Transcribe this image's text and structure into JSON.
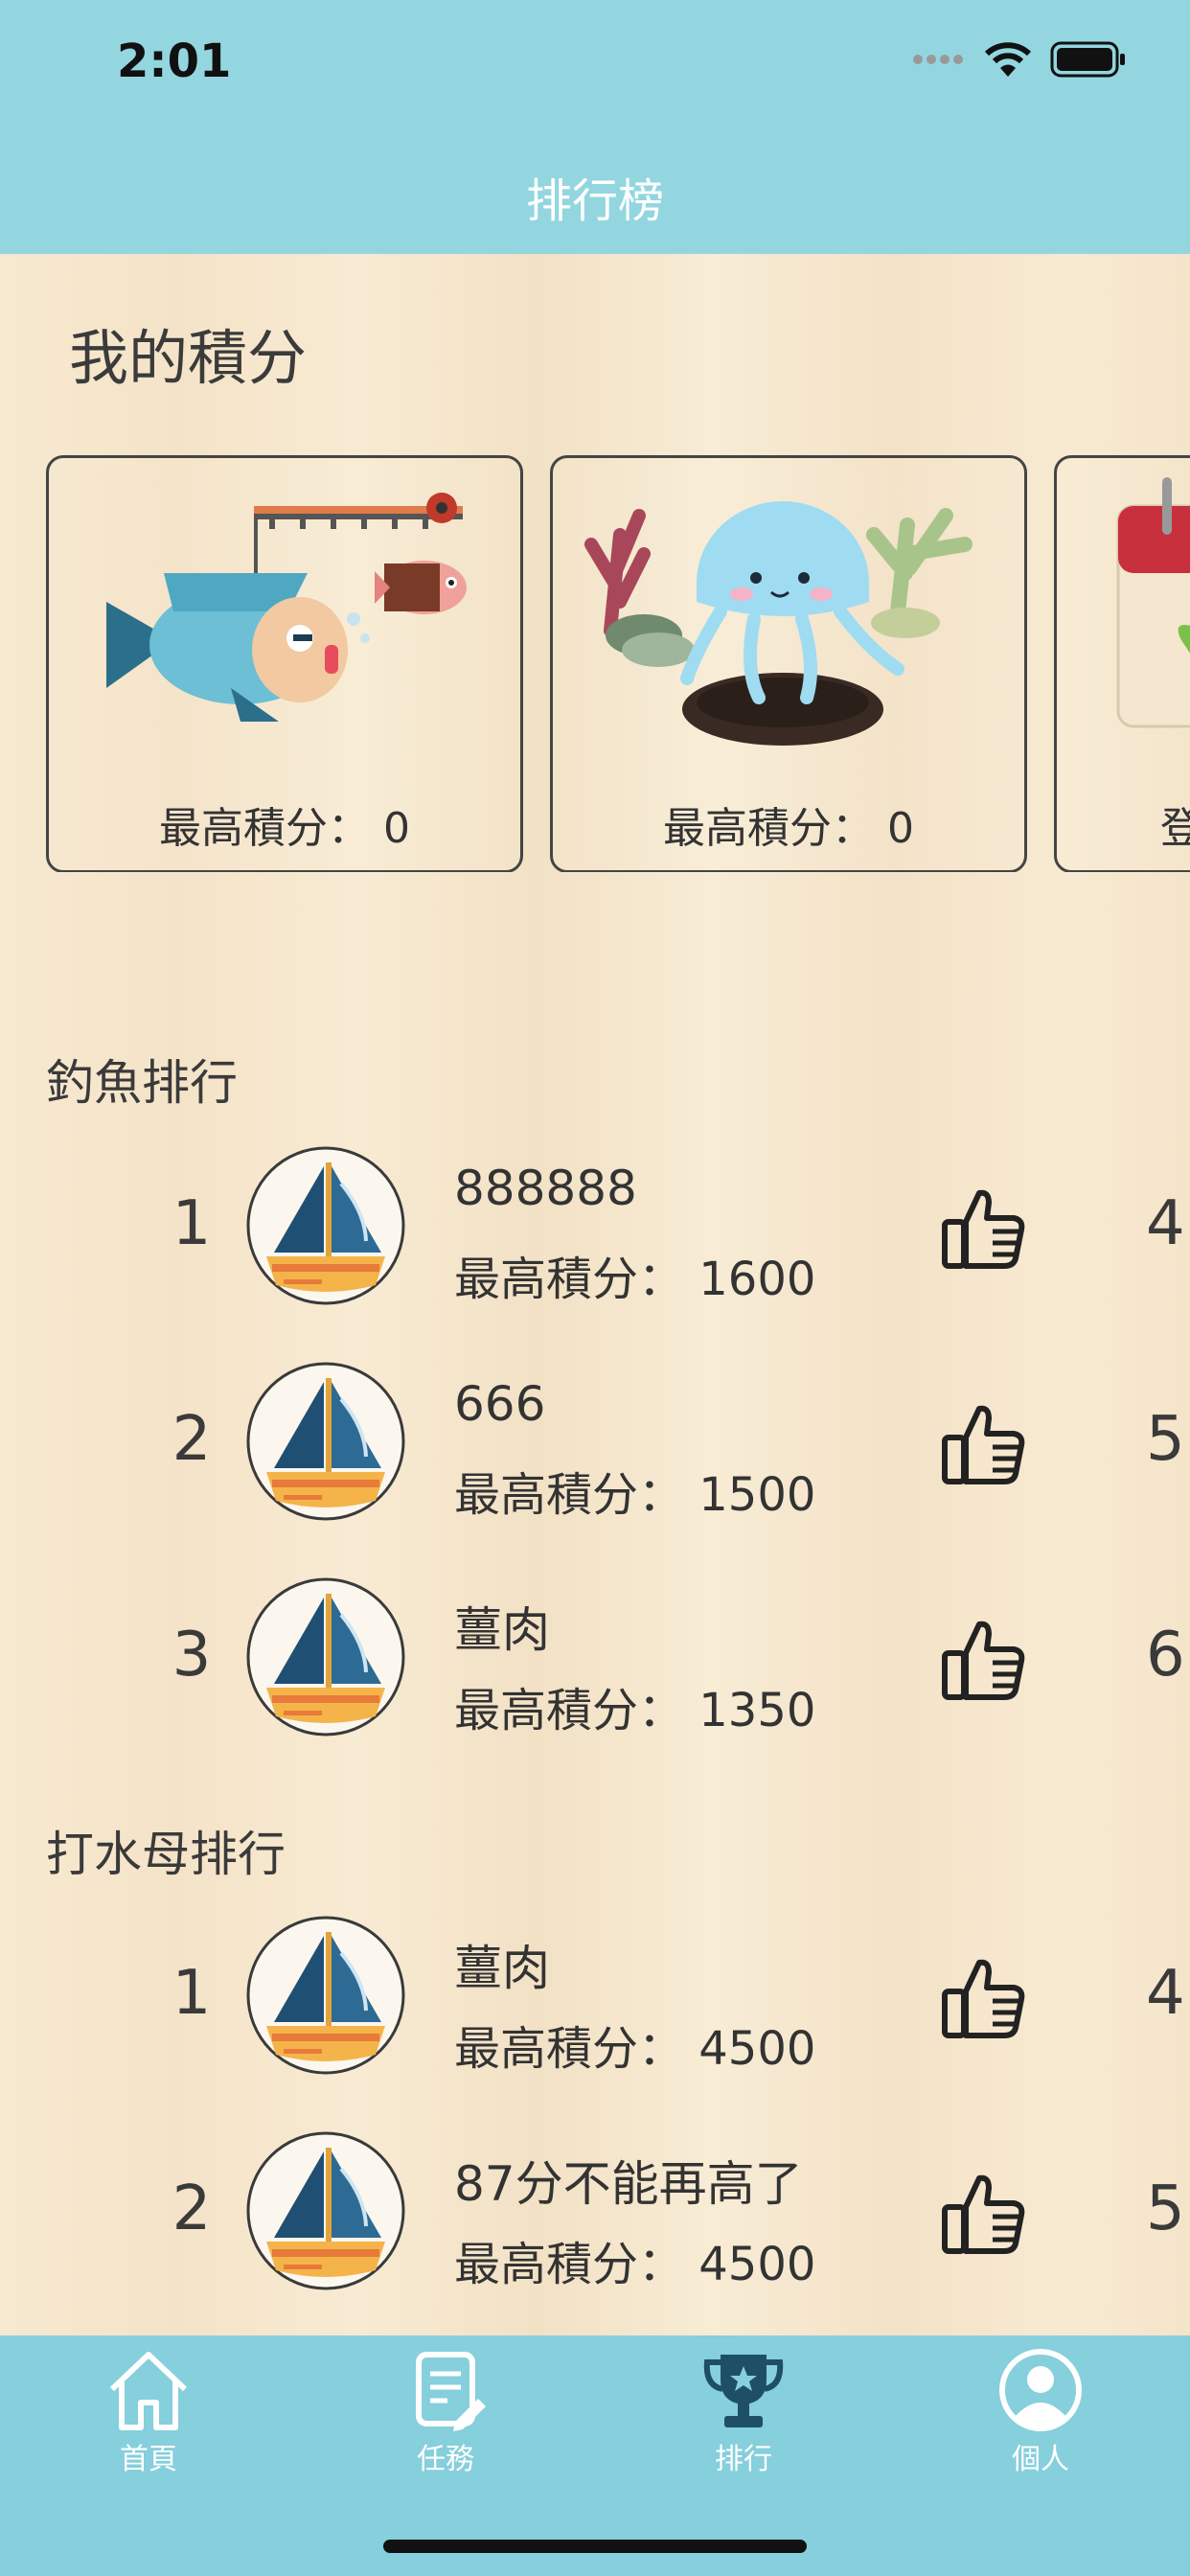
{
  "status_bar": {
    "time": "2:01"
  },
  "nav": {
    "title": "排行榜"
  },
  "my_score": {
    "title": "我的積分",
    "cards": [
      {
        "game": "fishing",
        "label": "最高積分：  0"
      },
      {
        "game": "jellyfish",
        "label": "最高積分：  0"
      },
      {
        "game": "calendar",
        "label": "登"
      }
    ]
  },
  "fishing_ranking": {
    "title": "釣魚排行",
    "rows": [
      {
        "rank": "1",
        "name": "888888",
        "score": "最高積分：  1600",
        "likes": "4"
      },
      {
        "rank": "2",
        "name": "666",
        "score": "最高積分：  1500",
        "likes": "5"
      },
      {
        "rank": "3",
        "name": "薑肉",
        "score": "最高積分：  1350",
        "likes": "6"
      }
    ]
  },
  "jellyfish_ranking": {
    "title": "打水母排行",
    "rows": [
      {
        "rank": "1",
        "name": "薑肉",
        "score": "最高積分：  4500",
        "likes": "4"
      },
      {
        "rank": "2",
        "name": "87分不能再高了",
        "score": "最高積分：  4500",
        "likes": "5"
      }
    ]
  },
  "tab_bar": {
    "tabs": [
      {
        "label": "首頁",
        "icon": "home-icon",
        "active": false
      },
      {
        "label": "任務",
        "icon": "task-icon",
        "active": false
      },
      {
        "label": "排行",
        "icon": "trophy-icon",
        "active": true
      },
      {
        "label": "個人",
        "icon": "person-icon",
        "active": false
      }
    ]
  },
  "colors": {
    "header": "#93d6e0",
    "tab_bar": "#86cfdc",
    "active_tab_icon": "#1f4f66",
    "background": "#f6e8cf"
  }
}
